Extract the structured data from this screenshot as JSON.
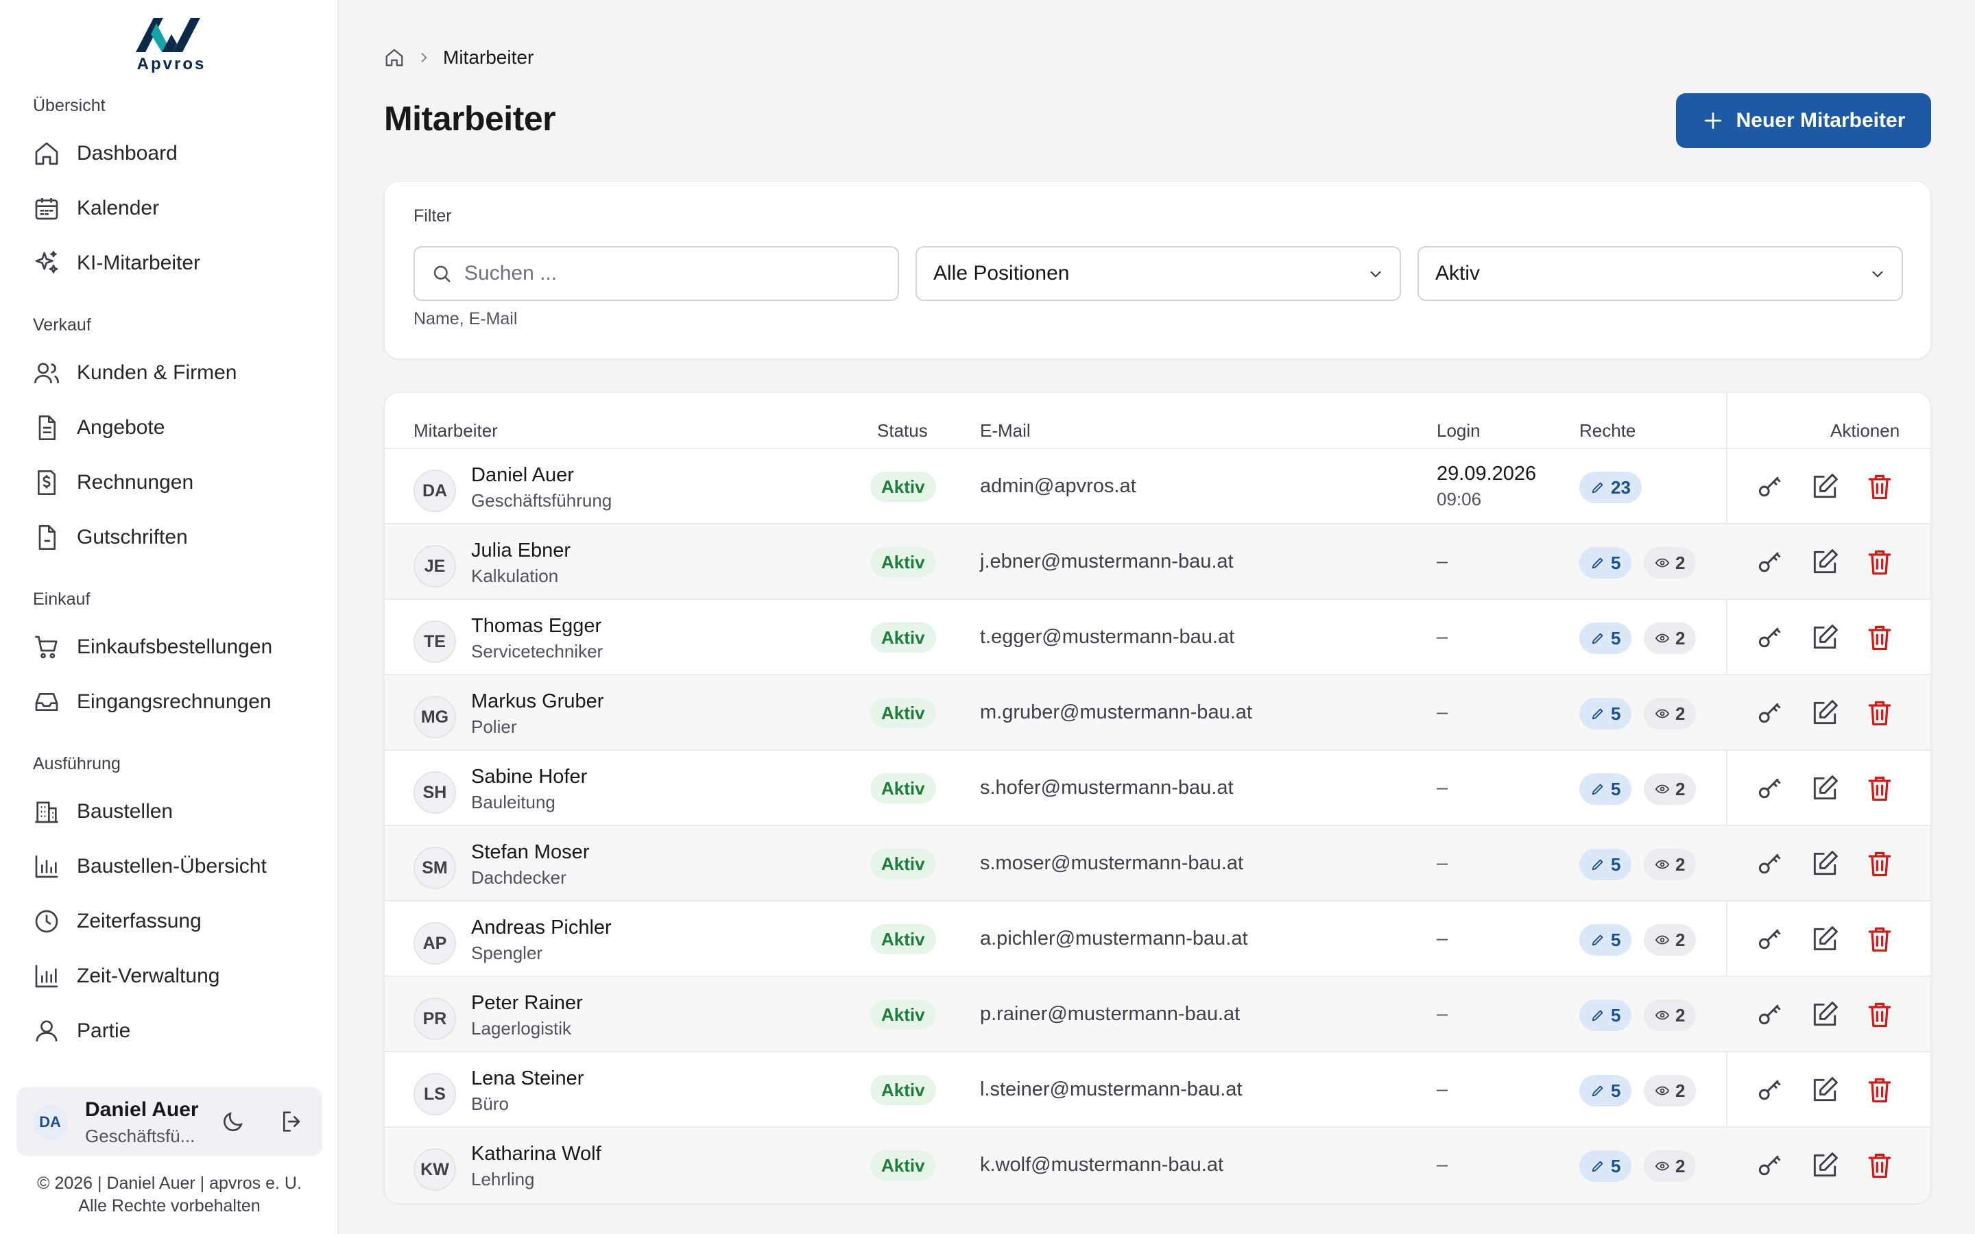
{
  "app": {
    "logo_text": "Apvros"
  },
  "sidebar": {
    "sections": [
      {
        "label": "Übersicht"
      },
      {
        "label": "Verkauf"
      },
      {
        "label": "Einkauf"
      },
      {
        "label": "Ausführung"
      }
    ],
    "items": [
      {
        "label": "Dashboard",
        "icon": "home-icon"
      },
      {
        "label": "Kalender",
        "icon": "calendar-icon"
      },
      {
        "label": "KI-Mitarbeiter",
        "icon": "sparkles-icon"
      },
      {
        "label": "Kunden & Firmen",
        "icon": "users-icon"
      },
      {
        "label": "Angebote",
        "icon": "document-icon"
      },
      {
        "label": "Rechnungen",
        "icon": "invoice-icon"
      },
      {
        "label": "Gutschriften",
        "icon": "file-icon"
      },
      {
        "label": "Einkaufsbestellungen",
        "icon": "cart-icon"
      },
      {
        "label": "Eingangsrechnungen",
        "icon": "inbox-icon"
      },
      {
        "label": "Baustellen",
        "icon": "building-icon"
      },
      {
        "label": "Baustellen-Übersicht",
        "icon": "bar-chart-icon"
      },
      {
        "label": "Zeiterfassung",
        "icon": "clock-icon"
      },
      {
        "label": "Zeit-Verwaltung",
        "icon": "bar-chart-icon"
      },
      {
        "label": "Partie",
        "icon": "user-icon"
      }
    ],
    "user": {
      "initials": "DA",
      "name": "Daniel Auer",
      "role": "Geschäftsfü..."
    },
    "footer": {
      "line1": "© 2026 | Daniel Auer | apvros e. U.",
      "line2": "Alle Rechte vorbehalten"
    }
  },
  "breadcrumb": {
    "current": "Mitarbeiter"
  },
  "page": {
    "title": "Mitarbeiter",
    "new_button": "Neuer Mitarbeiter"
  },
  "filter": {
    "label": "Filter",
    "search_placeholder": "Suchen ...",
    "search_hint": "Name, E-Mail",
    "position_select": "Alle Positionen",
    "status_select": "Aktiv"
  },
  "table": {
    "headers": {
      "employee": "Mitarbeiter",
      "status": "Status",
      "email": "E-Mail",
      "login": "Login",
      "rights": "Rechte",
      "actions": "Aktionen"
    },
    "rows": [
      {
        "initials": "DA",
        "name": "Daniel Auer",
        "position": "Geschäftsführung",
        "status": "Aktiv",
        "email": "admin@apvros.at",
        "login_date": "29.09.2026",
        "login_time": "09:06",
        "login_dash": "",
        "edit_rights": "23",
        "view_rights": ""
      },
      {
        "initials": "JE",
        "name": "Julia Ebner",
        "position": "Kalkulation",
        "status": "Aktiv",
        "email": "j.ebner@mustermann-bau.at",
        "login_date": "",
        "login_time": "",
        "login_dash": "–",
        "edit_rights": "5",
        "view_rights": "2"
      },
      {
        "initials": "TE",
        "name": "Thomas Egger",
        "position": "Servicetechniker",
        "status": "Aktiv",
        "email": "t.egger@mustermann-bau.at",
        "login_date": "",
        "login_time": "",
        "login_dash": "–",
        "edit_rights": "5",
        "view_rights": "2"
      },
      {
        "initials": "MG",
        "name": "Markus Gruber",
        "position": "Polier",
        "status": "Aktiv",
        "email": "m.gruber@mustermann-bau.at",
        "login_date": "",
        "login_time": "",
        "login_dash": "–",
        "edit_rights": "5",
        "view_rights": "2"
      },
      {
        "initials": "SH",
        "name": "Sabine Hofer",
        "position": "Bauleitung",
        "status": "Aktiv",
        "email": "s.hofer@mustermann-bau.at",
        "login_date": "",
        "login_time": "",
        "login_dash": "–",
        "edit_rights": "5",
        "view_rights": "2"
      },
      {
        "initials": "SM",
        "name": "Stefan Moser",
        "position": "Dachdecker",
        "status": "Aktiv",
        "email": "s.moser@mustermann-bau.at",
        "login_date": "",
        "login_time": "",
        "login_dash": "–",
        "edit_rights": "5",
        "view_rights": "2"
      },
      {
        "initials": "AP",
        "name": "Andreas Pichler",
        "position": "Spengler",
        "status": "Aktiv",
        "email": "a.pichler@mustermann-bau.at",
        "login_date": "",
        "login_time": "",
        "login_dash": "–",
        "edit_rights": "5",
        "view_rights": "2"
      },
      {
        "initials": "PR",
        "name": "Peter Rainer",
        "position": "Lagerlogistik",
        "status": "Aktiv",
        "email": "p.rainer@mustermann-bau.at",
        "login_date": "",
        "login_time": "",
        "login_dash": "–",
        "edit_rights": "5",
        "view_rights": "2"
      },
      {
        "initials": "LS",
        "name": "Lena Steiner",
        "position": "Büro",
        "status": "Aktiv",
        "email": "l.steiner@mustermann-bau.at",
        "login_date": "",
        "login_time": "",
        "login_dash": "–",
        "edit_rights": "5",
        "view_rights": "2"
      },
      {
        "initials": "KW",
        "name": "Katharina Wolf",
        "position": "Lehrling",
        "status": "Aktiv",
        "email": "k.wolf@mustermann-bau.at",
        "login_date": "",
        "login_time": "",
        "login_dash": "–",
        "edit_rights": "5",
        "view_rights": "2"
      }
    ]
  },
  "colors": {
    "primary": "#1d5aa3",
    "status_active_bg": "#e6f4ea",
    "status_active_text": "#1e7d3a",
    "delete": "#d11a1a",
    "logo_dark": "#0b2a4a",
    "logo_accent": "#12a4a8"
  }
}
